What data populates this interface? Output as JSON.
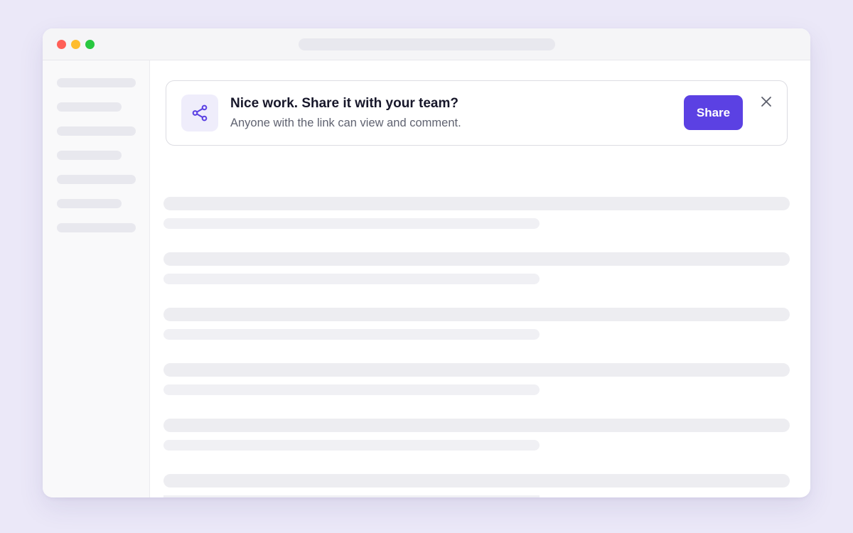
{
  "window": {
    "traffic_lights": {
      "close_color": "#ff5f57",
      "minimize_color": "#febc2e",
      "zoom_color": "#28c840"
    }
  },
  "banner": {
    "icon": "share-icon",
    "title": "Nice work. Share it with your team?",
    "subtitle": "Anyone with the link can view and comment.",
    "share_label": "Share",
    "close_icon": "close-icon",
    "accent_color": "#5b41e3"
  }
}
